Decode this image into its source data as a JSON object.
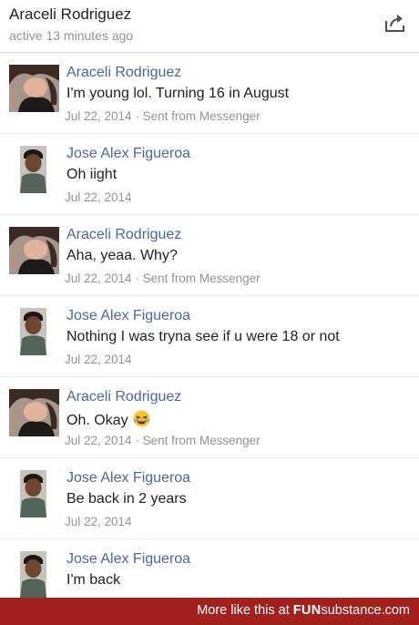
{
  "header": {
    "title": "Araceli Rodriguez",
    "status": "active 13 minutes ago",
    "share_icon": "share-icon"
  },
  "messages": [
    {
      "sender": "Araceli Rodriguez",
      "text": "I'm young lol. Turning 16 in August",
      "date": "Jul 22, 2014",
      "via": "Sent from Messenger"
    },
    {
      "sender": "Jose Alex Figueroa",
      "text": "Oh iight",
      "date": "Jul 22, 2014"
    },
    {
      "sender": "Araceli Rodriguez",
      "text": "Aha, yeaa. Why?",
      "date": "Jul 22, 2014",
      "via": "Sent from Messenger"
    },
    {
      "sender": "Jose Alex Figueroa",
      "text": "Nothing I was tryna see if u were 18 or not",
      "date": "Jul 22, 2014"
    },
    {
      "sender": "Araceli Rodriguez",
      "text": "Oh. Okay",
      "emoji": "laughing-emoji",
      "date": "Jul 22, 2014",
      "via": "Sent from Messenger"
    },
    {
      "sender": "Jose Alex Figueroa",
      "text": "Be back in 2 years",
      "date": "Jul 22, 2014"
    },
    {
      "sender": "Jose Alex Figueroa",
      "text": "I'm back"
    }
  ],
  "separator": "·",
  "footer": {
    "prefix": "More like this at",
    "brand_bold": "FUN",
    "brand_rest": "substance.com",
    "color": "#a3211c"
  }
}
